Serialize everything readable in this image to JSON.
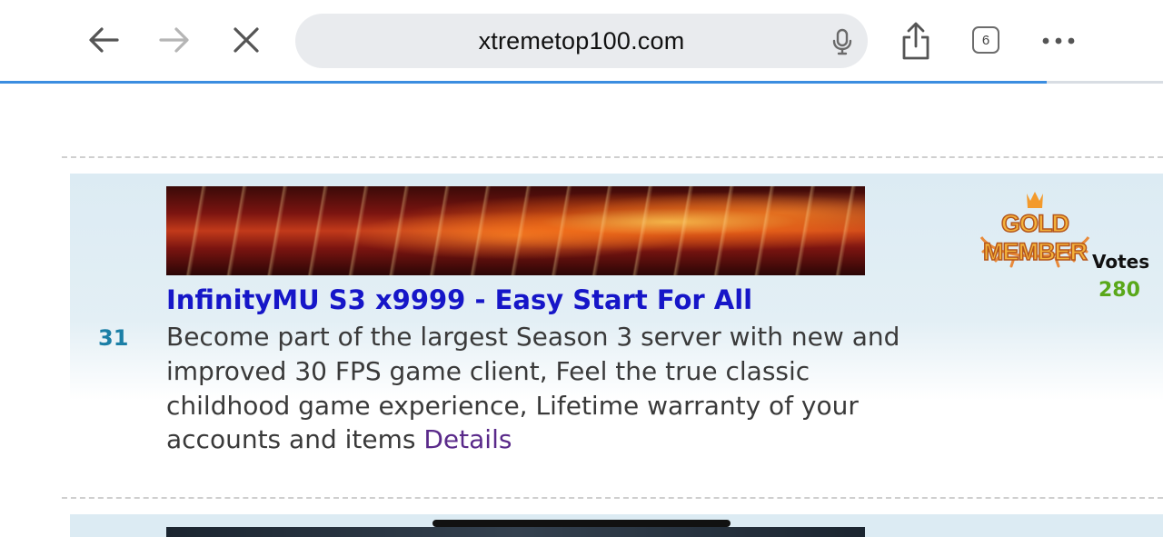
{
  "browser": {
    "url": "xtremetop100.com",
    "tab_count": "6",
    "load_progress": 0.9,
    "icons": {
      "back": "back-arrow-icon",
      "forward": "forward-arrow-icon",
      "stop": "close-icon",
      "mic": "microphone-icon",
      "share": "share-icon",
      "tabs": "tabs-icon",
      "more": "more-icon"
    }
  },
  "listing": {
    "rank": "31",
    "title": "InfinityMU S3 x9999 - Easy Start For All",
    "description": "Become part of the largest Season 3 server with new and improved 30 FPS game client, Feel the true classic childhood game experience, Lifetime warranty of your accounts and items",
    "details_link": "Details",
    "badge_text": "GOLD MEMBER",
    "votes_label": "Votes",
    "votes_value": "280"
  },
  "colors": {
    "title": "#1616c8",
    "rank": "#1b7fa6",
    "votes": "#5aa81a",
    "details": "#5a2a8a",
    "progress": "#3b8de0"
  }
}
